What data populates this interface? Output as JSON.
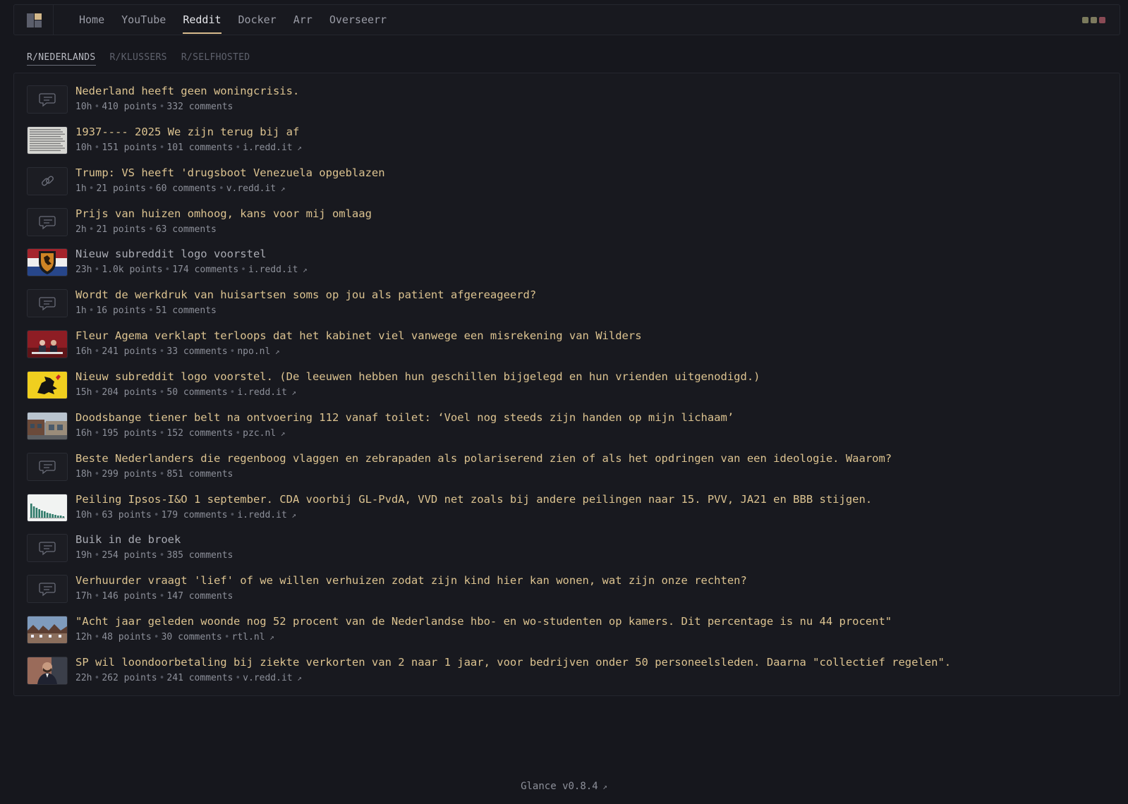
{
  "nav": {
    "items": [
      "Home",
      "YouTube",
      "Reddit",
      "Docker",
      "Arr",
      "Overseerr"
    ],
    "active": "Reddit"
  },
  "theme_colors": [
    "#7a7a5c",
    "#7d7a5e",
    "#8a4a55"
  ],
  "subreddit_tabs": {
    "items": [
      "R/NEDERLANDS",
      "R/KLUSSERS",
      "R/SELFHOSTED"
    ],
    "active": "R/NEDERLANDS"
  },
  "posts": [
    {
      "title": "Nederland heeft geen woningcrisis.",
      "age": "10h",
      "points": "410 points",
      "comments": "332 comments",
      "domain": "",
      "thumb": "comment-icon",
      "visited": false
    },
    {
      "title": "1937---- 2025 We zijn terug bij af",
      "age": "10h",
      "points": "151 points",
      "comments": "101 comments",
      "domain": "i.redd.it",
      "thumb": "text-image",
      "visited": false
    },
    {
      "title": "Trump: VS heeft 'drugsboot Venezuela opgeblazen",
      "age": "1h",
      "points": "21 points",
      "comments": "60 comments",
      "domain": "v.redd.it",
      "thumb": "link-icon",
      "visited": false
    },
    {
      "title": "Prijs van huizen omhoog, kans voor mij omlaag",
      "age": "2h",
      "points": "21 points",
      "comments": "63 comments",
      "domain": "",
      "thumb": "comment-icon",
      "visited": false
    },
    {
      "title": "Nieuw subreddit logo voorstel",
      "age": "23h",
      "points": "1.0k points",
      "comments": "174 comments",
      "domain": "i.redd.it",
      "thumb": "dutch-flag-lion",
      "visited": true
    },
    {
      "title": "Wordt de werkdruk van huisartsen soms op jou als patient afgereageerd?",
      "age": "1h",
      "points": "16 points",
      "comments": "51 comments",
      "domain": "",
      "thumb": "comment-icon",
      "visited": false
    },
    {
      "title": "Fleur Agema verklapt terloops dat het kabinet viel vanwege een misrekening van Wilders",
      "age": "16h",
      "points": "241 points",
      "comments": "33 comments",
      "domain": "npo.nl",
      "thumb": "red-studio",
      "visited": false
    },
    {
      "title": "Nieuw subreddit logo voorstel. (De leeuwen hebben hun geschillen bijgelegd en hun vrienden uitgenodigd.)",
      "age": "15h",
      "points": "204 points",
      "comments": "50 comments",
      "domain": "i.redd.it",
      "thumb": "yellow-lion",
      "visited": false
    },
    {
      "title": "Doodsbange tiener belt na ontvoering 112 vanaf toilet: ‘Voel nog steeds zijn handen op mijn lichaam’",
      "age": "16h",
      "points": "195 points",
      "comments": "152 comments",
      "domain": "pzc.nl",
      "thumb": "street-photo",
      "visited": false
    },
    {
      "title": "Beste Nederlanders die regenboog vlaggen en zebrapaden als polariserend zien of als het opdringen van een ideologie. Waarom?",
      "age": "18h",
      "points": "299 points",
      "comments": "851 comments",
      "domain": "",
      "thumb": "comment-icon",
      "visited": false
    },
    {
      "title": "Peiling Ipsos-I&O 1 september. CDA voorbij GL-PvdA, VVD net zoals bij andere peilingen naar 15. PVV, JA21 en BBB stijgen.",
      "age": "10h",
      "points": "63 points",
      "comments": "179 comments",
      "domain": "i.redd.it",
      "thumb": "poll-chart",
      "visited": false
    },
    {
      "title": "Buik in de broek",
      "age": "19h",
      "points": "254 points",
      "comments": "385 comments",
      "domain": "",
      "thumb": "comment-icon",
      "visited": true
    },
    {
      "title": "Verhuurder vraagt 'lief' of we willen verhuizen zodat zijn kind hier kan wonen, wat zijn onze rechten?",
      "age": "17h",
      "points": "146 points",
      "comments": "147 comments",
      "domain": "",
      "thumb": "comment-icon",
      "visited": false
    },
    {
      "title": "\"Acht jaar geleden woonde nog 52 procent van de Nederlandse hbo- en wo-studenten op kamers. Dit percentage is nu 44 procent\"",
      "age": "12h",
      "points": "48 points",
      "comments": "30 comments",
      "domain": "rtl.nl",
      "thumb": "houses-photo",
      "visited": false
    },
    {
      "title": "SP wil loondoorbetaling bij ziekte verkorten van 2 naar 1 jaar, voor bedrijven onder 50 personeelsleden. Daarna \"collectief regelen\".",
      "age": "22h",
      "points": "262 points",
      "comments": "241 comments",
      "domain": "v.redd.it",
      "thumb": "man-portrait",
      "visited": false
    }
  ],
  "footer": {
    "label": "Glance v0.8.4"
  }
}
